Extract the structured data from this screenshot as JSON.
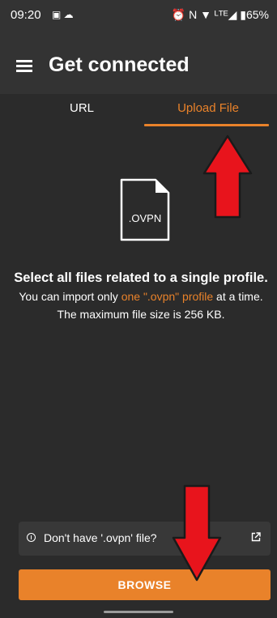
{
  "status_bar": {
    "time": "09:20",
    "left_icons": "▣ ☁",
    "right_icons": "⏰ N ▼ ᴸᵀᴱ◢ ▮",
    "battery": "65%"
  },
  "app_bar": {
    "title": "Get connected"
  },
  "tabs": [
    {
      "label": "URL",
      "selected": false
    },
    {
      "label": "Upload File",
      "selected": true
    }
  ],
  "file_icon": {
    "label": ".OVPN"
  },
  "instructions": {
    "heading": "Select all files related to a single profile.",
    "body_prefix": "You can import only ",
    "body_link": "one \".ovpn\" profile",
    "body_suffix": " at a time.",
    "size_note": "The maximum file size is 256 KB."
  },
  "help_row": {
    "label": "Don't have '.ovpn' file?"
  },
  "browse_button": {
    "label": "BROWSE"
  },
  "colors": {
    "accent": "#e9822a",
    "background": "#2b2b2b",
    "app_bar": "#333333",
    "annotation_arrow": "#e8141c"
  },
  "icons": [
    "menu-icon",
    "info-icon",
    "external-link-icon",
    "file-icon"
  ]
}
